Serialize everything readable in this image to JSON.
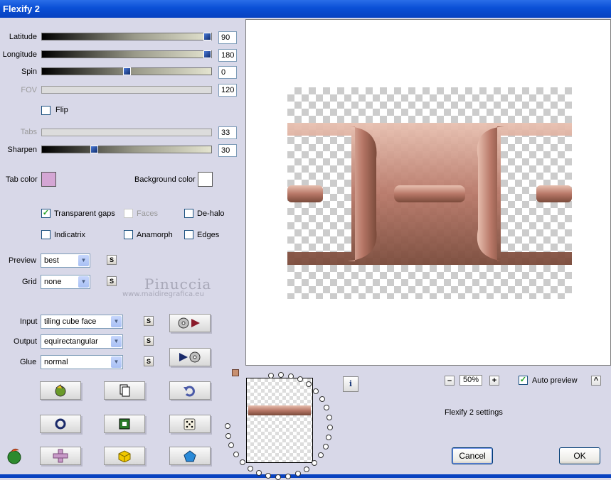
{
  "window": {
    "title": "Flexify 2"
  },
  "sliders": [
    {
      "label": "Latitude",
      "value": "90",
      "fraction": 1.0,
      "enabled": true
    },
    {
      "label": "Longitude",
      "value": "180",
      "fraction": 1.0,
      "enabled": true
    },
    {
      "label": "Spin",
      "value": "0",
      "fraction": 0.5,
      "enabled": true
    },
    {
      "label": "FOV",
      "value": "120",
      "fraction": 0.0,
      "enabled": false
    },
    {
      "label": "Tabs",
      "value": "33",
      "fraction": 0.0,
      "enabled": false
    },
    {
      "label": "Sharpen",
      "value": "30",
      "fraction": 0.3,
      "enabled": true
    }
  ],
  "flip": {
    "label": "Flip",
    "checked": false
  },
  "colors": {
    "tab_color_label": "Tab color",
    "tab_color": "#d4a6d4",
    "background_color_label": "Background color",
    "background_color": "#ffffff"
  },
  "options": {
    "transparent_gaps": {
      "label": "Transparent gaps",
      "checked": true
    },
    "faces": {
      "label": "Faces",
      "checked": false,
      "enabled": false
    },
    "de_halo": {
      "label": "De-halo",
      "checked": false
    },
    "indicatrix": {
      "label": "Indicatrix",
      "checked": false
    },
    "anamorph": {
      "label": "Anamorph",
      "checked": false
    },
    "edges": {
      "label": "Edges",
      "checked": false
    }
  },
  "dropdowns": {
    "preview": {
      "label": "Preview",
      "value": "best"
    },
    "grid": {
      "label": "Grid",
      "value": "none"
    },
    "input": {
      "label": "Input",
      "value": "tiling cube face"
    },
    "output": {
      "label": "Output",
      "value": "equirectangular"
    },
    "glue": {
      "label": "Glue",
      "value": "normal"
    }
  },
  "s_button_label": "S",
  "watermark": {
    "name": "Pinuccia",
    "url": "www.maidiregrafica.eu"
  },
  "zoom": {
    "minus": "–",
    "value": "50%",
    "plus": "+"
  },
  "auto_preview": {
    "label": "Auto preview",
    "checked": true
  },
  "collapse_label": "^",
  "info_label": "i",
  "settings_label": "Flexify 2 settings",
  "buttons": {
    "cancel": "Cancel",
    "ok": "OK"
  },
  "accent": {
    "titlebar": "#0a4fd6",
    "rope": "#c08878"
  }
}
